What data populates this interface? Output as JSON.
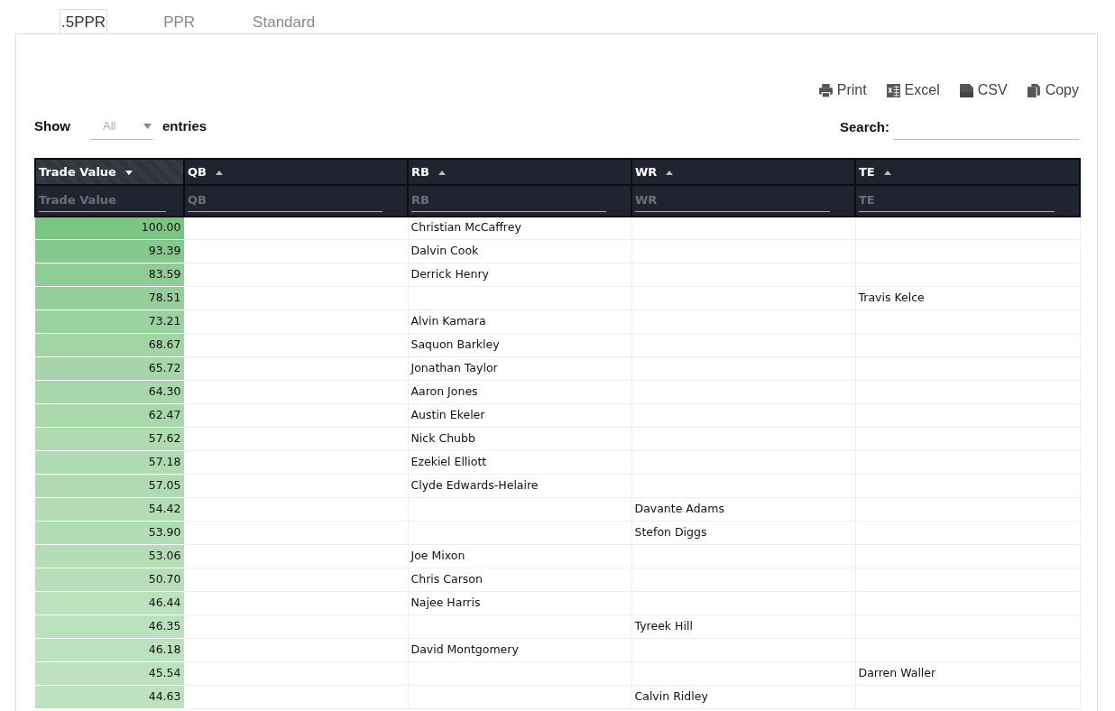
{
  "tabs": [
    {
      "label": ".5PPR",
      "selected": true
    },
    {
      "label": "PPR",
      "selected": false
    },
    {
      "label": "Standard",
      "selected": false
    }
  ],
  "export_buttons": [
    {
      "kind": "print",
      "label": "Print"
    },
    {
      "kind": "excel",
      "label": "Excel"
    },
    {
      "kind": "csv",
      "label": "CSV"
    },
    {
      "kind": "copy",
      "label": "Copy"
    }
  ],
  "length_control": {
    "before": "Show",
    "value": "All",
    "after": "entries"
  },
  "search": {
    "label": "Search:"
  },
  "table": {
    "columns": [
      {
        "label": "Trade Value",
        "sorted": true,
        "filter_placeholder": "Trade Value"
      },
      {
        "label": "QB",
        "sorted": false,
        "filter_placeholder": "QB"
      },
      {
        "label": "RB",
        "sorted": false,
        "filter_placeholder": "RB"
      },
      {
        "label": "WR",
        "sorted": false,
        "filter_placeholder": "WR"
      },
      {
        "label": "TE",
        "sorted": false,
        "filter_placeholder": "TE"
      }
    ],
    "rows": [
      [
        "100.00",
        null,
        "Christian McCaffrey",
        null,
        null
      ],
      [
        "93.39",
        null,
        "Dalvin Cook",
        null,
        null
      ],
      [
        "83.59",
        null,
        "Derrick Henry",
        null,
        null
      ],
      [
        "78.51",
        null,
        null,
        null,
        "Travis Kelce"
      ],
      [
        "73.21",
        null,
        "Alvin Kamara",
        null,
        null
      ],
      [
        "68.67",
        null,
        "Saquon Barkley",
        null,
        null
      ],
      [
        "65.72",
        null,
        "Jonathan Taylor",
        null,
        null
      ],
      [
        "64.30",
        null,
        "Aaron Jones",
        null,
        null
      ],
      [
        "62.47",
        null,
        "Austin Ekeler",
        null,
        null
      ],
      [
        "57.62",
        null,
        "Nick Chubb",
        null,
        null
      ],
      [
        "57.18",
        null,
        "Ezekiel Elliott",
        null,
        null
      ],
      [
        "57.05",
        null,
        "Clyde Edwards-Helaire",
        null,
        null
      ],
      [
        "54.42",
        null,
        null,
        "Davante Adams",
        null
      ],
      [
        "53.90",
        null,
        null,
        "Stefon Diggs",
        null
      ],
      [
        "53.06",
        null,
        "Joe Mixon",
        null,
        null
      ],
      [
        "50.70",
        null,
        "Chris Carson",
        null,
        null
      ],
      [
        "46.44",
        null,
        "Najee Harris",
        null,
        null
      ],
      [
        "46.35",
        null,
        null,
        "Tyreek Hill",
        null
      ],
      [
        "46.18",
        null,
        "David Montgomery",
        null,
        null
      ],
      [
        "45.54",
        null,
        null,
        null,
        "Darren Waller"
      ],
      [
        "44.63",
        null,
        null,
        "Calvin Ridley",
        null
      ]
    ]
  }
}
